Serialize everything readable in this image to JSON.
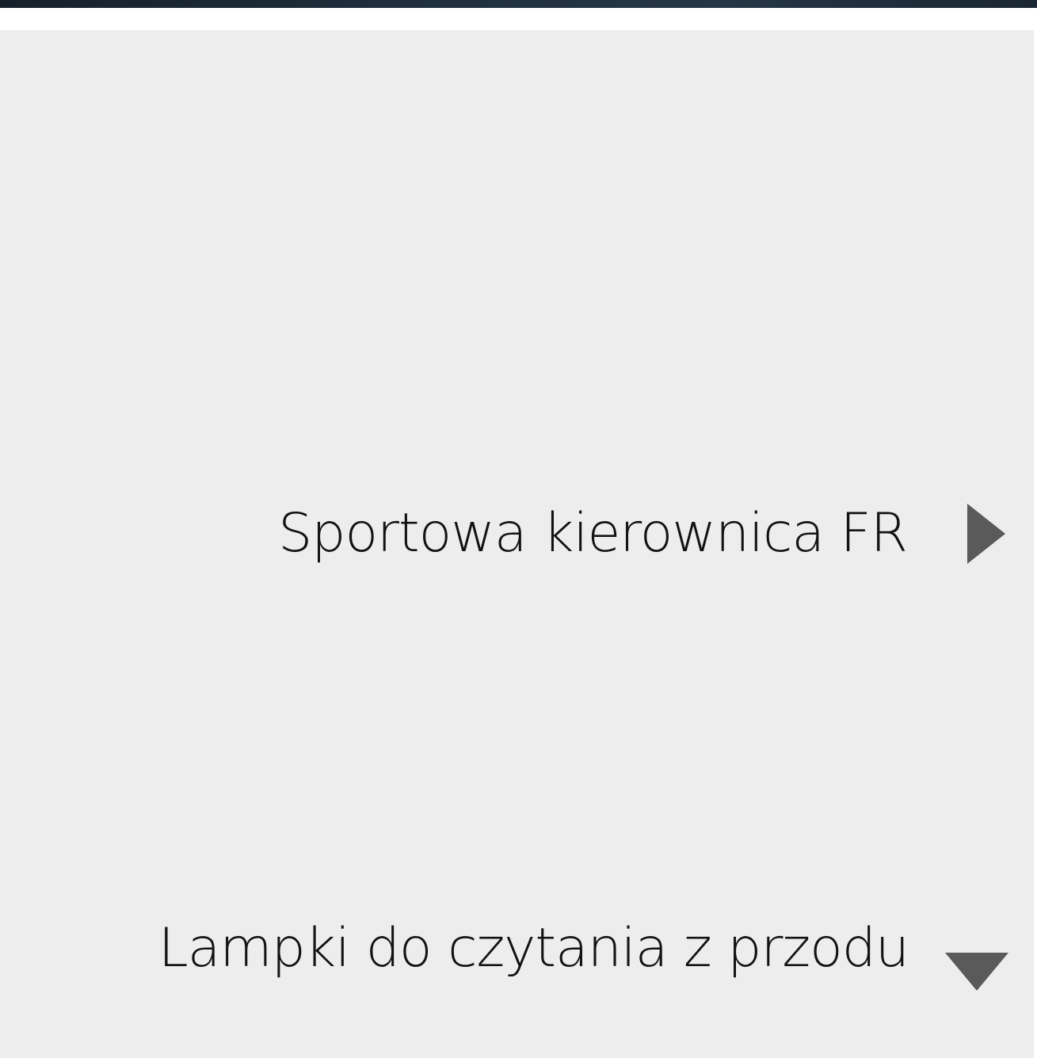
{
  "features": {
    "items": [
      {
        "label": "Sportowa kierownica FR",
        "icon": "play-right-triangle-icon",
        "state": "collapsed"
      },
      {
        "label": "Lampki do czytania z przodu",
        "icon": "caret-down-triangle-icon",
        "state": "expanded"
      }
    ]
  },
  "colors": {
    "panel_background": "#ededed",
    "text": "#121212",
    "icon": "#5a5a5a",
    "top_image_strip": "#1f2f3d"
  }
}
